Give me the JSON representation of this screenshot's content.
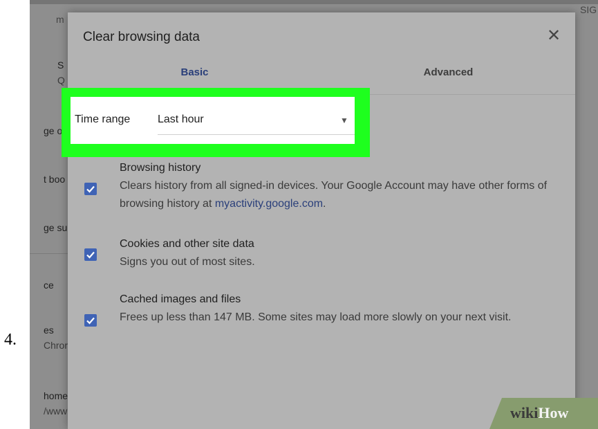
{
  "step": {
    "number": "4."
  },
  "background": {
    "top_left_text": "m",
    "top_right_text": "SIG",
    "items": [
      {
        "label": "S",
        "sub": "Q"
      },
      {
        "label": "ge ot"
      },
      {
        "label": "t boo"
      },
      {
        "label": "ge su"
      },
      {
        "label": "ce"
      },
      {
        "label": "es",
        "sub": "Chror"
      },
      {
        "label": "home",
        "sub": "/www"
      }
    ]
  },
  "dialog": {
    "title": "Clear browsing data",
    "close_icon": "close-icon",
    "tabs": [
      {
        "label": "Basic",
        "selected": true
      },
      {
        "label": "Advanced",
        "selected": false
      }
    ],
    "time_range": {
      "label": "Time range",
      "value": "Last hour"
    },
    "options": [
      {
        "title": "Browsing history",
        "desc_before_link": "Clears history from all signed-in devices. Your Google Account may have other forms of browsing history at ",
        "link": "myactivity.google.com",
        "desc_after_link": ".",
        "checked": true
      },
      {
        "title": "Cookies and other site data",
        "desc": "Signs you out of most sites.",
        "checked": true
      },
      {
        "title": "Cached images and files",
        "desc": "Frees up less than 147 MB. Some sites may load more slowly on your next visit.",
        "checked": true
      }
    ]
  },
  "watermark": {
    "part1": "wiki",
    "part2": "How"
  },
  "colors": {
    "highlight": "#1eff1e",
    "accent": "#2a3f7a",
    "checkbox": "#3f63b5",
    "dialog_bg": "#b3b3b3"
  }
}
